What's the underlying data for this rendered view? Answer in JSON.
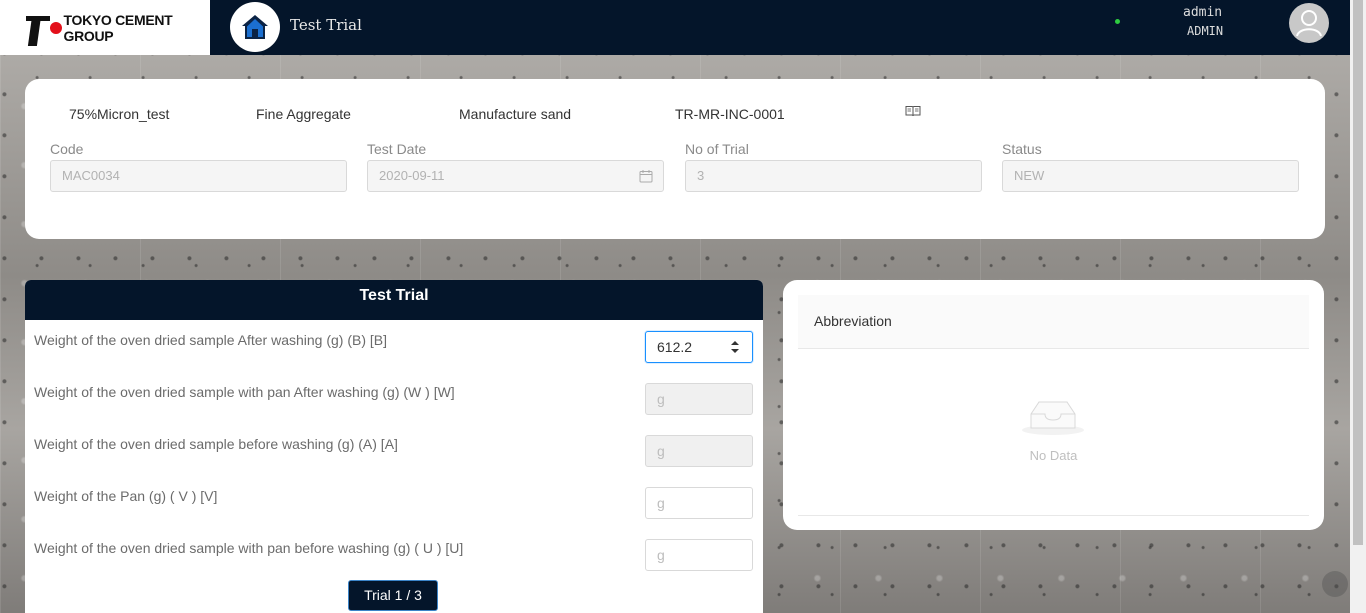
{
  "header": {
    "brand": "TOKYO CEMENT GROUP",
    "app_title": "Test Trial",
    "user_name": "admin",
    "user_role": "ADMIN"
  },
  "info": {
    "test_name": "75%Micron_test",
    "category": "Fine Aggregate",
    "material": "Manufacture sand",
    "reference": "TR-MR-INC-0001"
  },
  "fields": [
    {
      "label": "Code",
      "value": "MAC0034"
    },
    {
      "label": "Test Date",
      "value": "2020-09-11"
    },
    {
      "label": "No of Trial",
      "value": "3"
    },
    {
      "label": "Status",
      "value": "NEW"
    }
  ],
  "trial": {
    "title": "Test Trial",
    "rows": [
      {
        "label": "Weight of the oven dried sample After washing (g) (B) [B]",
        "value": "612.2"
      },
      {
        "label": "Weight of the oven dried sample with pan After washing (g) (W ) [W]",
        "placeholder": "g"
      },
      {
        "label": "Weight of the oven dried sample before washing (g) (A) [A]",
        "placeholder": "g"
      },
      {
        "label": "Weight of the Pan (g) ( V ) [V]",
        "placeholder": "g"
      },
      {
        "label": "Weight of the oven dried sample with pan before washing (g) ( U ) [U]",
        "placeholder": "g"
      }
    ],
    "pager": "Trial 1 / 3"
  },
  "abbreviation": {
    "title": "Abbreviation",
    "empty_text": "No Data"
  },
  "icons": {
    "home": "home-icon",
    "book": "book-icon",
    "calendar": "calendar-icon",
    "user": "user-icon",
    "empty": "inbox-icon"
  },
  "colors": {
    "navy": "#04152a",
    "accent": "#1890ff",
    "online": "#2ecc40"
  }
}
